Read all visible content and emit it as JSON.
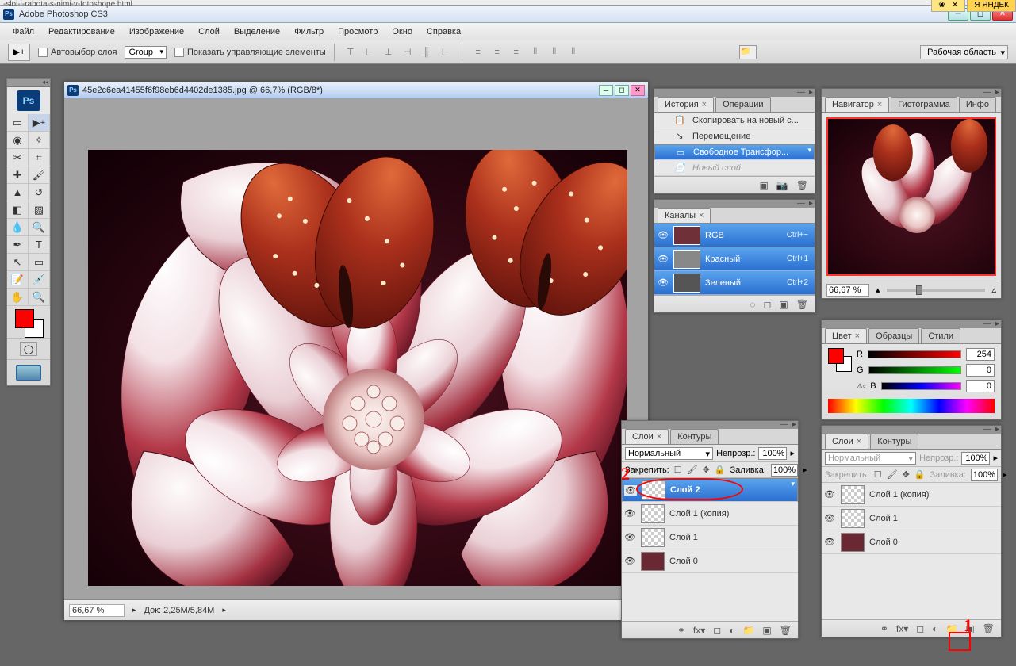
{
  "app_title": "Adobe Photoshop CS3",
  "browser_url_frag": "-sloi-i-rabota-s-nimi-v-fotoshope.html",
  "menu": [
    "Файл",
    "Редактирование",
    "Изображение",
    "Слой",
    "Выделение",
    "Фильтр",
    "Просмотр",
    "Окно",
    "Справка"
  ],
  "options": {
    "autoselect": "Автовыбор слоя",
    "group": "Group",
    "show_controls": "Показать управляющие элементы",
    "workspace": "Рабочая область"
  },
  "doc": {
    "title": "45e2c6ea41455f6f98eb6d4402de1385.jpg @ 66,7% (RGB/8*)",
    "zoom": "66,67 %",
    "docsize": "Док: 2,25M/5,84M"
  },
  "history": {
    "tab1": "История",
    "tab2": "Операции",
    "items": [
      {
        "label": "Скопировать на новый с...",
        "icon": "📋"
      },
      {
        "label": "Перемещение",
        "icon": "↘"
      },
      {
        "label": "Свободное Трансфор...",
        "icon": "▭",
        "sel": true
      },
      {
        "label": "Новый слой",
        "icon": "📄",
        "dim": true
      }
    ]
  },
  "channels": {
    "tab": "Каналы",
    "items": [
      {
        "name": "RGB",
        "sc": "Ctrl+~"
      },
      {
        "name": "Красный",
        "sc": "Ctrl+1"
      },
      {
        "name": "Зеленый",
        "sc": "Ctrl+2"
      }
    ]
  },
  "navigator": {
    "tabs": [
      "Навигатор",
      "Гистограмма",
      "Инфо"
    ],
    "zoom": "66,67 %"
  },
  "color": {
    "tabs": [
      "Цвет",
      "Образцы",
      "Стили"
    ],
    "r": "254",
    "g": "0",
    "b": "0"
  },
  "layers_panel_float": {
    "tabs": [
      "Слои",
      "Контуры"
    ],
    "mode": "Нормальный",
    "opacity_lbl": "Непрозр.:",
    "opacity": "100%",
    "lock_lbl": "Закрепить:",
    "fill_lbl": "Заливка:",
    "fill": "100%",
    "items": [
      {
        "name": "Слой 2",
        "sel": true,
        "trans": true
      },
      {
        "name": "Слой 1 (копия)",
        "trans": true
      },
      {
        "name": "Слой 1",
        "trans": true
      },
      {
        "name": "Слой 0",
        "trans": false
      }
    ]
  },
  "layers_panel_dock": {
    "tabs": [
      "Слои",
      "Контуры"
    ],
    "mode": "Нормальный",
    "opacity_lbl": "Непрозр.:",
    "opacity": "100%",
    "lock_lbl": "Закрепить:",
    "fill_lbl": "Заливка:",
    "fill": "100%",
    "items": [
      {
        "name": "Слой 1 (копия)",
        "trans": true
      },
      {
        "name": "Слой 1",
        "trans": true
      },
      {
        "name": "Слой 0",
        "trans": false
      }
    ]
  },
  "annotations": {
    "a1": "1",
    "a2": "2"
  }
}
